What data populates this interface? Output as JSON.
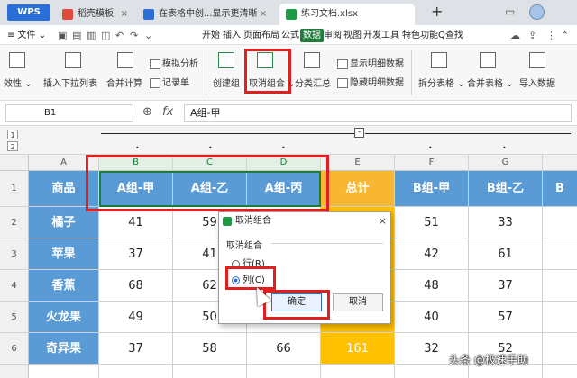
{
  "titlebar": {
    "app": "WPS",
    "tabs": [
      {
        "label": "稻壳模板",
        "close": "×"
      },
      {
        "label": "在表格中创...显示更清晰",
        "close": "×"
      },
      {
        "label": "练习文档.xlsx",
        "close": ""
      }
    ],
    "plus": "+",
    "extra_symbol": "▭"
  },
  "menubar": {
    "file_menu": "≡ 文件 ⌄",
    "items": [
      "开始",
      "插入",
      "页面布局",
      "公式",
      "数据",
      "审阅",
      "视图",
      "开发工具",
      "特色功能"
    ],
    "active": "数据",
    "search": "Q查找"
  },
  "ribbon": {
    "validity": "效性 ⌄",
    "dropdown_list": "插入下拉列表",
    "merge_calc": "合并计算",
    "sim_analysis": "模拟分析",
    "record_list": "记录单",
    "create_group": "创建组",
    "ungroup": "取消组合 ⌄",
    "subtotal": "分类汇总",
    "show_detail": "显示明细数据",
    "hide_detail": "隐藏明细数据",
    "split_table": "拆分表格 ⌄",
    "merge_table": "合并表格 ⌄",
    "import_data": "导入数据"
  },
  "formulabar": {
    "cell_ref": "B1",
    "content": "A组-甲"
  },
  "outline": {
    "levels": [
      "1",
      "2"
    ],
    "collapse": "-"
  },
  "sheet": {
    "col_headers": [
      "A",
      "B",
      "C",
      "D",
      "E",
      "F",
      "G"
    ],
    "row_headers": [
      "1",
      "2",
      "3",
      "4",
      "5",
      "6"
    ],
    "header_row": [
      "商品",
      "A组-甲",
      "A组-乙",
      "A组-丙",
      "总计",
      "B组-甲",
      "B组-乙",
      "B"
    ],
    "rows": [
      [
        "橘子",
        "41",
        "59",
        "",
        "",
        "51",
        "33"
      ],
      [
        "苹果",
        "37",
        "41",
        "",
        "",
        "42",
        "61"
      ],
      [
        "香蕉",
        "68",
        "62",
        "",
        "",
        "48",
        "37"
      ],
      [
        "火龙果",
        "49",
        "50",
        "",
        "",
        "40",
        "57"
      ],
      [
        "奇异果",
        "37",
        "58",
        "66",
        "161",
        "32",
        "52"
      ]
    ]
  },
  "dialog": {
    "title": "取消组合",
    "close": "×",
    "group_label": "取消组合",
    "option_row": "行(R)",
    "option_col": "列(C)",
    "ok": "确定",
    "cancel": "取消"
  },
  "watermark": "头条 @极速手助",
  "colors": {
    "header_blue": "#5b9bd5",
    "total_orange": "#ffc000",
    "highlight_red": "#e02020",
    "data_tab_green": "#1e7d3a"
  }
}
